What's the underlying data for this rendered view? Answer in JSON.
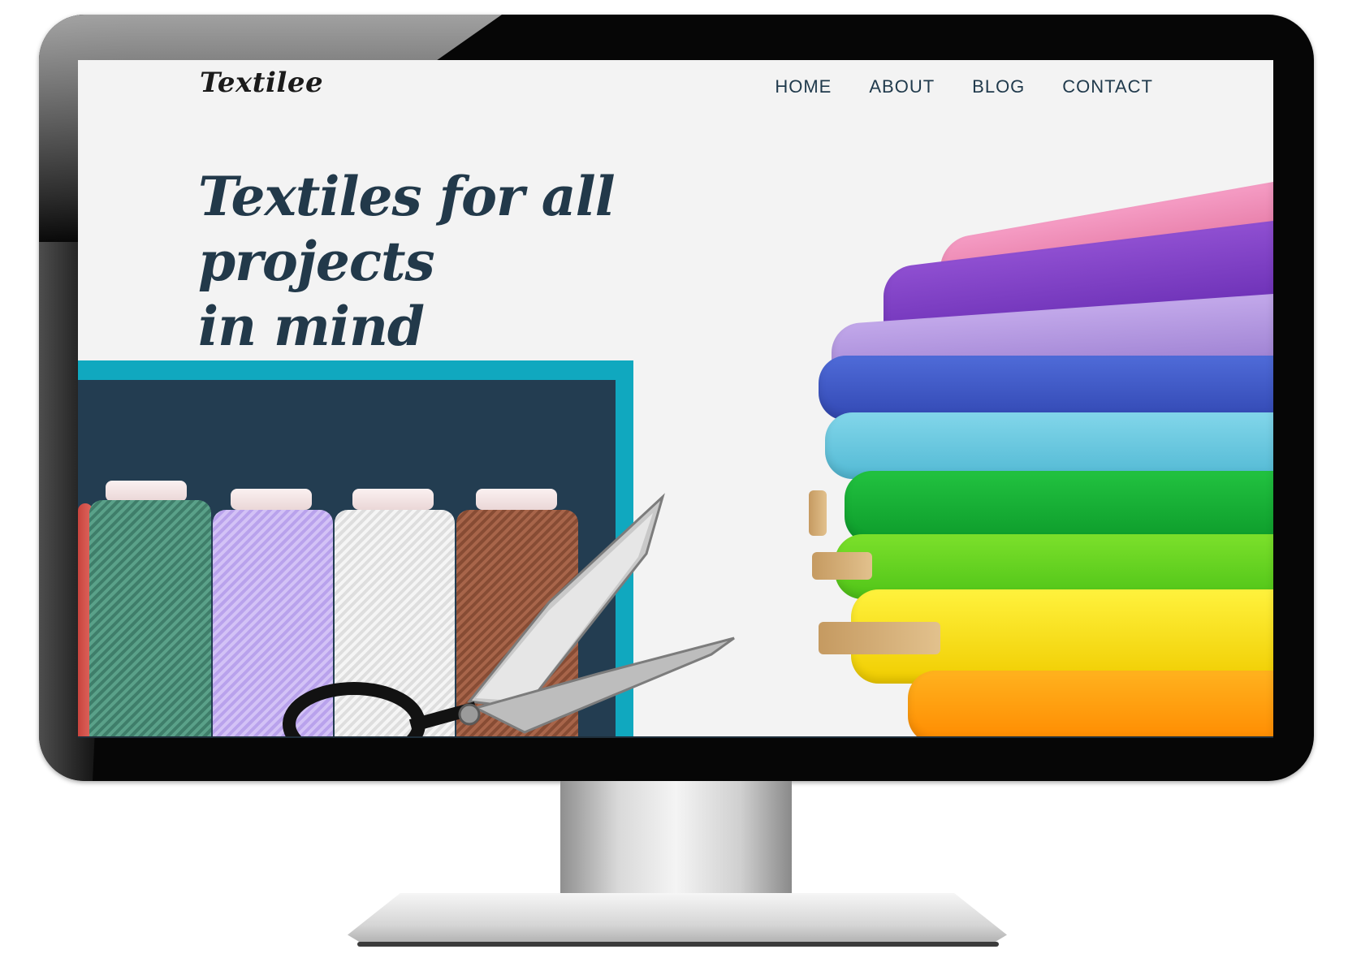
{
  "site": {
    "logo": "Textilee",
    "nav": {
      "items": [
        {
          "label": "HOME"
        },
        {
          "label": "ABOUT"
        },
        {
          "label": "BLOG"
        },
        {
          "label": "CONTACT"
        }
      ]
    },
    "hero": {
      "headline_line1": "Textiles for all projects",
      "headline_line2": "in mind"
    }
  },
  "icons": {
    "hero_left": "thread-spools-image",
    "tool": "scissors-icon",
    "hero_right": "fabric-rolls-image"
  },
  "colors": {
    "navy": "#233d51",
    "teal": "#10a8bf",
    "text": "#22394a",
    "background": "#f3f3f3"
  }
}
